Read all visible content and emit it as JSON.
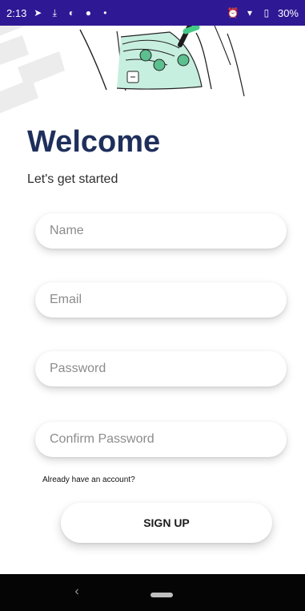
{
  "status_bar": {
    "time": "2:13",
    "battery": "30%",
    "icons_left": [
      "navigation-arrow-icon",
      "download-icon",
      "half-circle-icon",
      "filled-circle-icon",
      "dot-icon"
    ],
    "icons_right": [
      "alarm-icon",
      "wifi-icon",
      "battery-icon"
    ]
  },
  "screen": {
    "title": "Welcome",
    "subtitle": "Let's get started"
  },
  "form": {
    "name": {
      "placeholder": "Name",
      "value": ""
    },
    "email": {
      "placeholder": "Email",
      "value": ""
    },
    "password": {
      "placeholder": "Password",
      "value": ""
    },
    "confirm_password": {
      "placeholder": "Confirm Password",
      "value": ""
    },
    "login_link": "Already have an account?",
    "signup_label": "SIGN UP"
  },
  "colors": {
    "status_bar": "#2f1894",
    "title": "#1f2f5c",
    "illustration_green": "#7ed9b6",
    "navigation_bar": "#050505"
  }
}
